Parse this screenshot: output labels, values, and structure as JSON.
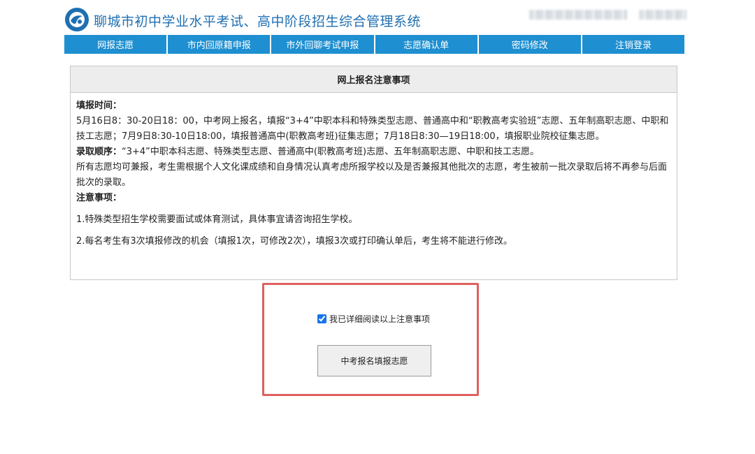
{
  "header": {
    "system_title": "聊城市初中学业水平考试、高中阶段招生综合管理系统",
    "logo_icon": "swirl-logo-icon",
    "brand_color": "#1f6fb2"
  },
  "nav": {
    "items": [
      {
        "label": "网报志愿"
      },
      {
        "label": "市内回原籍申报"
      },
      {
        "label": "市外回聊考试申报"
      },
      {
        "label": "志愿确认单"
      },
      {
        "label": "密码修改"
      },
      {
        "label": "注销登录"
      }
    ],
    "bg_color": "#1e8fd0"
  },
  "notice": {
    "title": "网上报名注意事项",
    "fill_time_label": "填报时间：",
    "fill_time_text": "5月16日8：30-20日18：00，中考网上报名，填报“3+4”中职本科和特殊类型志愿、普通高中和“职教高考实验班”志愿、五年制高职志愿、中职和技工志愿；7月9日8:30-10日18:00，填报普通高中(职教高考班)征集志愿；7月18日8:30—19日18:00，填报职业院校征集志愿。",
    "order_label": "录取顺序：",
    "order_text": "“3+4”中职本科志愿、特殊类型志愿、普通高中(职教高考班)志愿、五年制高职志愿、中职和技工志愿。",
    "all_text": "所有志愿均可兼报，考生需根据个人文化课成绩和自身情况认真考虑所报学校以及是否兼报其他批次的志愿，考生被前一批次录取后将不再参与后面批次的录取。",
    "notes_label": "注意事项：",
    "note1": "1.特殊类型招生学校需要面试或体育测试，具体事宜请咨询招生学校。",
    "note2": "2.每名考生有3次填报修改的机会（填报1次，可修改2次），填报3次或打印确认单后，考生将不能进行修改。"
  },
  "agreement": {
    "checkbox_label": "我已详细阅读以上注意事项",
    "checked": true
  },
  "action": {
    "apply_button_label": "中考报名填报志愿"
  },
  "highlight_color": "#e06060"
}
